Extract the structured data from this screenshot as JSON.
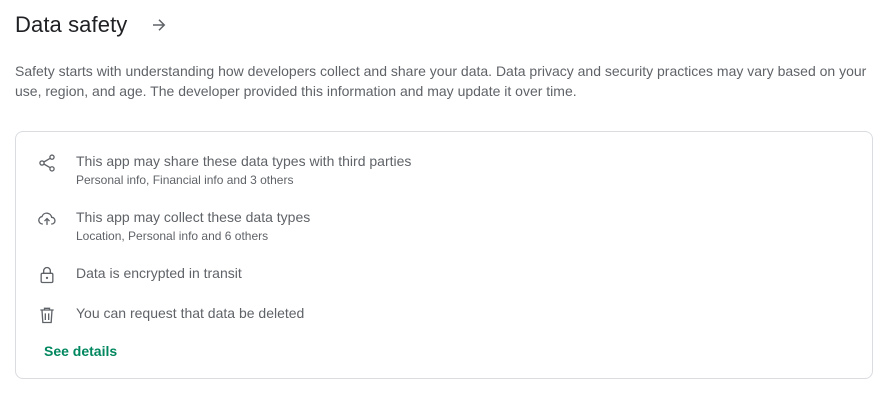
{
  "section": {
    "title": "Data safety",
    "description": "Safety starts with understanding how developers collect and share your data. Data privacy and security practices may vary based on your use, region, and age. The developer provided this information and may update it over time."
  },
  "items": [
    {
      "icon": "share-icon",
      "primary": "This app may share these data types with third parties",
      "secondary": "Personal info, Financial info and 3 others"
    },
    {
      "icon": "cloud-upload-icon",
      "primary": "This app may collect these data types",
      "secondary": "Location, Personal info and 6 others"
    },
    {
      "icon": "lock-icon",
      "primary": "Data is encrypted in transit"
    },
    {
      "icon": "trash-icon",
      "primary": "You can request that data be deleted"
    }
  ],
  "link": {
    "label": "See details",
    "color": "#01875f"
  }
}
